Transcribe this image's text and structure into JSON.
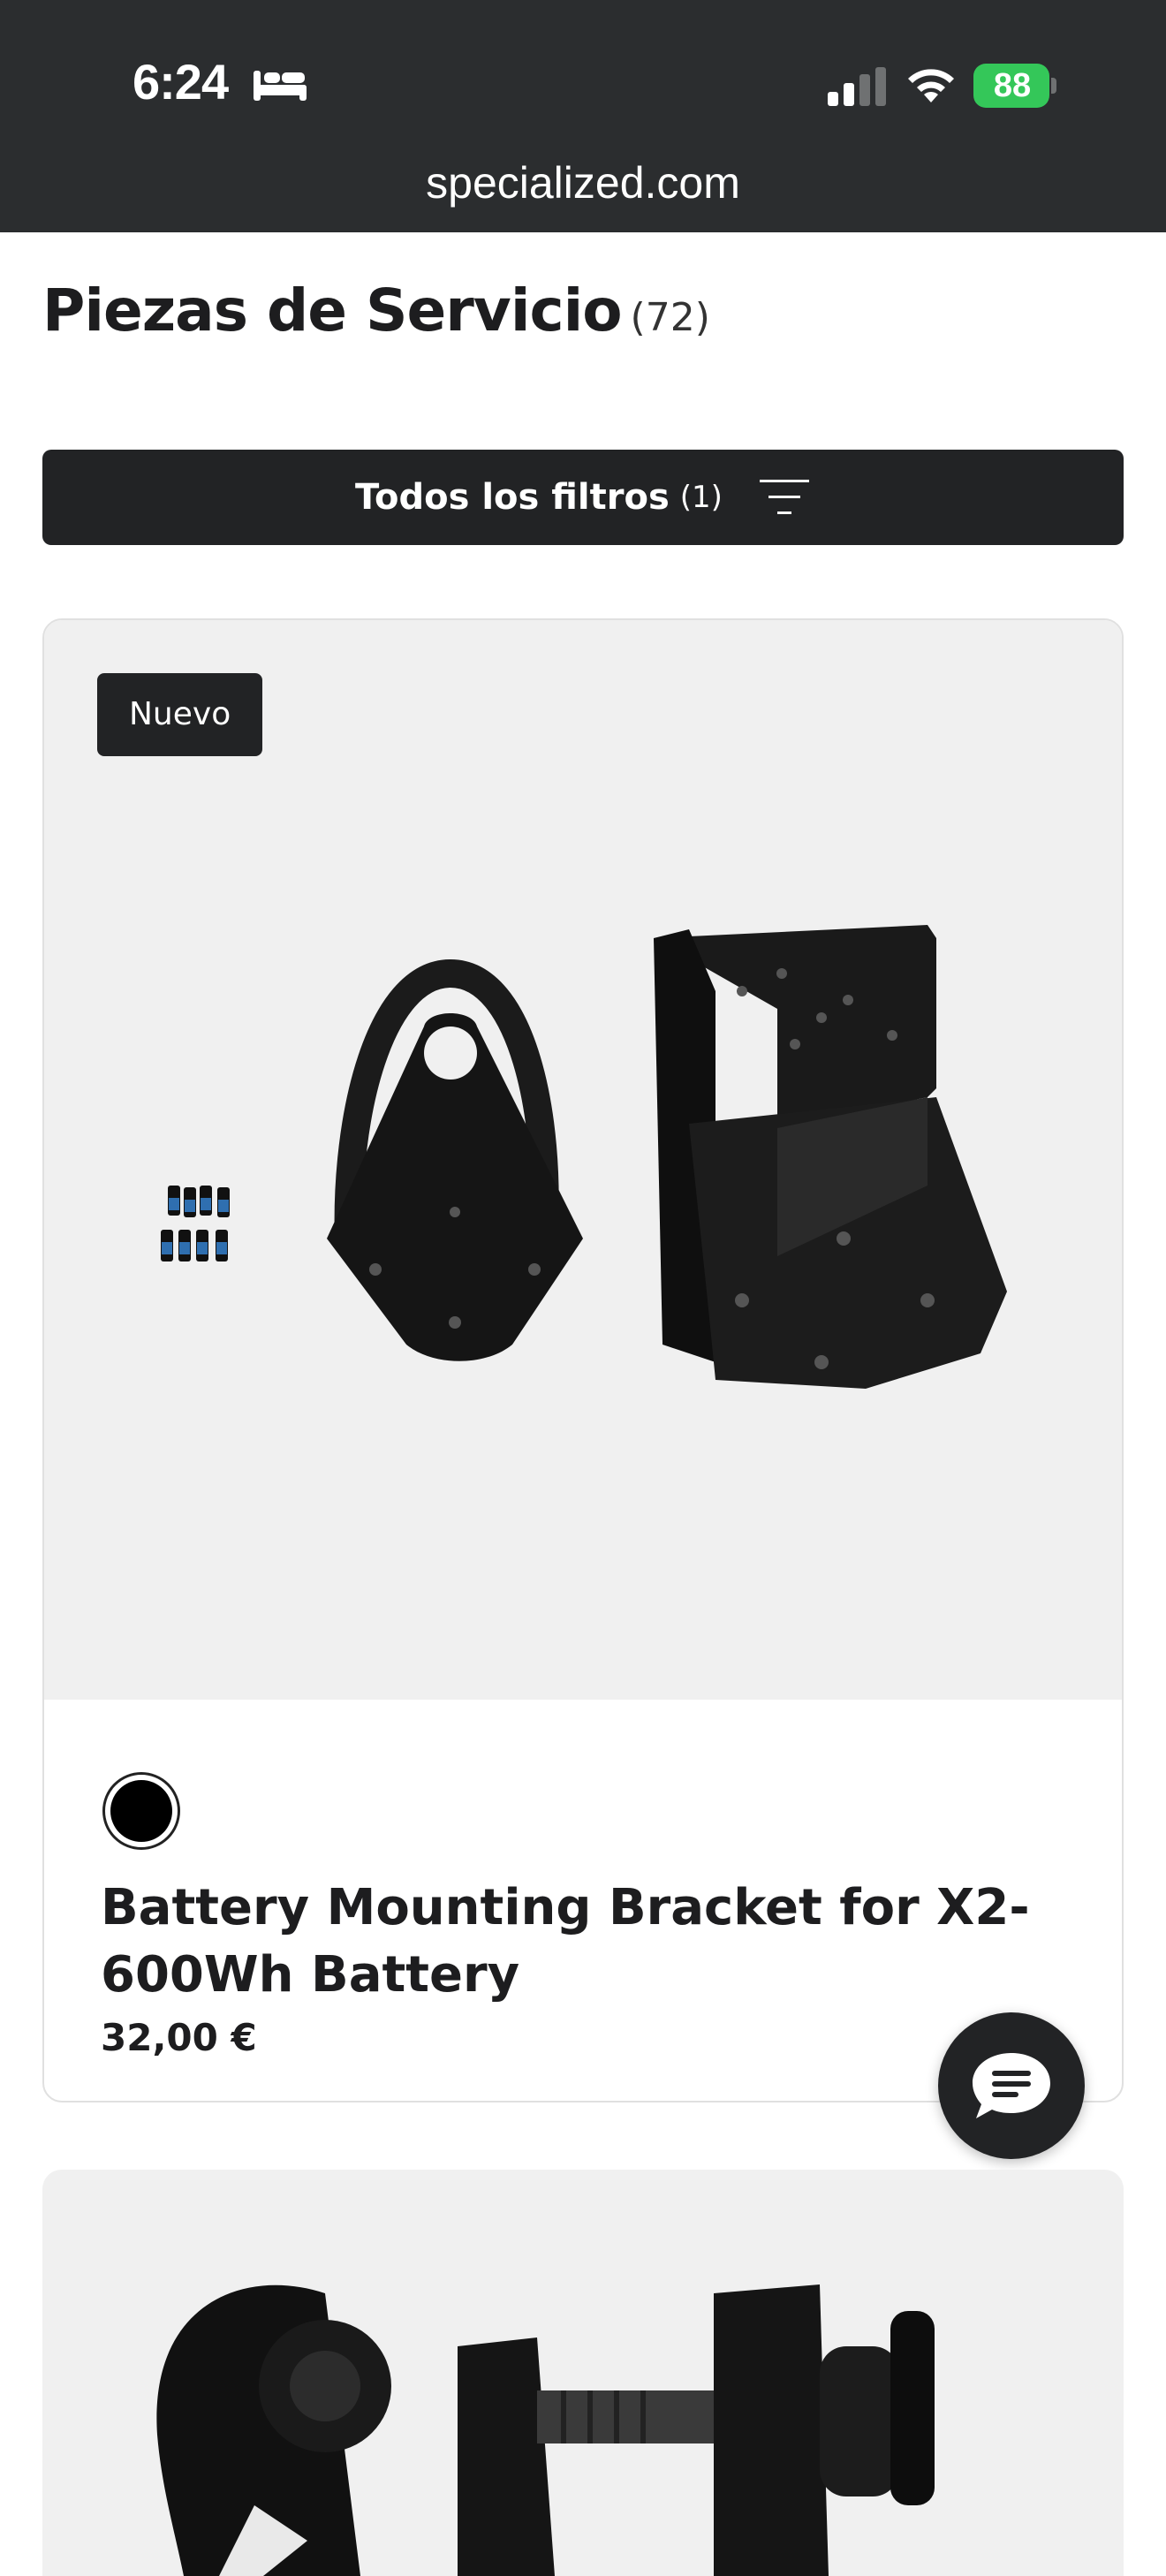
{
  "status_bar": {
    "time": "6:24",
    "battery": "88",
    "battery_color": "#34c759",
    "icons": [
      "bed-icon",
      "signal-icon",
      "wifi-icon",
      "battery-icon"
    ]
  },
  "browser": {
    "url": "specialized.com"
  },
  "header": {
    "title": "Piezas de Servicio",
    "count": "(72)",
    "filters_label": "Todos los filtros",
    "filters_count": "(1)"
  },
  "products": [
    {
      "badge": "Nuevo",
      "color_swatch": "#000000",
      "name": "Battery Mounting Bracket for X2-600Wh Battery",
      "price": "32,00 €"
    }
  ],
  "chat": {
    "icon": "chat-icon"
  },
  "colors": {
    "dark": "#222325",
    "topbar": "#2b2d2f",
    "card_bg": "#f0f0f0"
  }
}
